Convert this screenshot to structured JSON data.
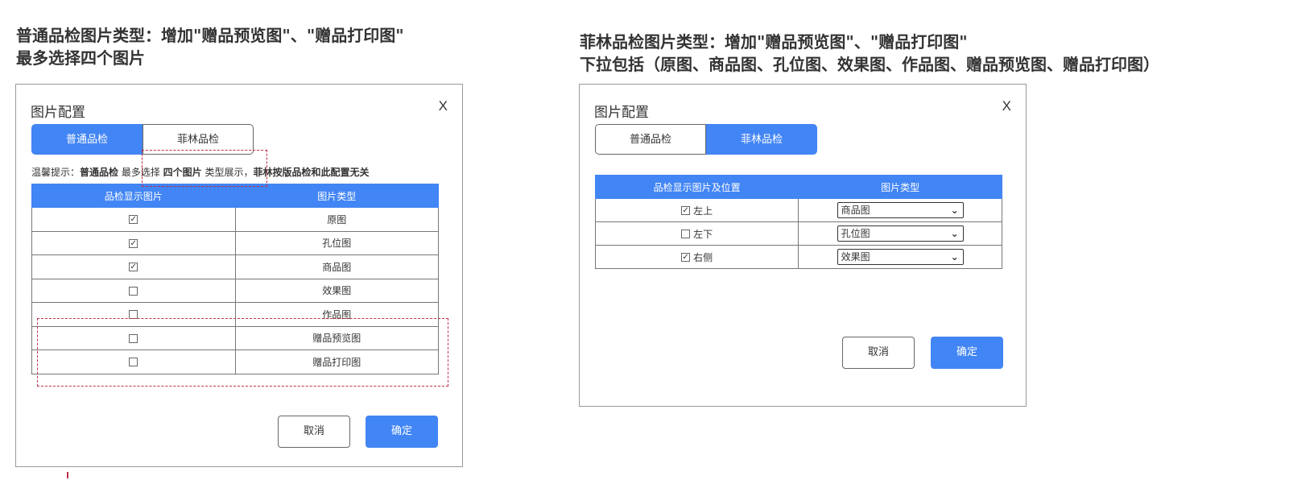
{
  "left_panel": {
    "heading_line1": "普通品检图片类型：增加\"赠品预览图\"、\"赠品打印图\"",
    "heading_line2": "最多选择四个图片",
    "dialog": {
      "title": "图片配置",
      "close": "X",
      "tabs": [
        {
          "label": "普通品检",
          "active": true
        },
        {
          "label": "菲林品检",
          "active": false
        }
      ],
      "tip": {
        "prefix": "温馨提示：",
        "b1": "普通品检",
        "mid1": " 最多选择 ",
        "b2": "四个图片",
        "mid2": " 类型展示，",
        "b3": "菲林按版品检和此配置无关"
      },
      "table": {
        "headers": [
          "品检显示图片",
          "图片类型"
        ],
        "rows": [
          {
            "checked": true,
            "type": "原图"
          },
          {
            "checked": true,
            "type": "孔位图"
          },
          {
            "checked": true,
            "type": "商品图"
          },
          {
            "checked": false,
            "type": "效果图"
          },
          {
            "checked": false,
            "type": "作品图"
          },
          {
            "checked": false,
            "type": "赠品预览图"
          },
          {
            "checked": false,
            "type": "赠品打印图"
          }
        ]
      },
      "cancel": "取消",
      "ok": "确定"
    }
  },
  "right_panel": {
    "heading_line1": "菲林品检图片类型：增加\"赠品预览图\"、\"赠品打印图\"",
    "heading_line2": "下拉包括（原图、商品图、孔位图、效果图、作品图、赠品预览图、赠品打印图）",
    "dialog": {
      "title": "图片配置",
      "close": "X",
      "tabs": [
        {
          "label": "普通品检",
          "active": false
        },
        {
          "label": "菲林品检",
          "active": true
        }
      ],
      "table": {
        "headers": [
          "品检显示图片及位置",
          "图片类型"
        ],
        "rows": [
          {
            "checked": true,
            "position": "左上",
            "type": "商品图"
          },
          {
            "checked": false,
            "position": "左下",
            "type": "孔位图"
          },
          {
            "checked": true,
            "position": "右侧",
            "type": "效果图"
          }
        ]
      },
      "cancel": "取消",
      "ok": "确定"
    }
  },
  "check_glyph": "✓",
  "chevron_glyph": "⌄",
  "colors": {
    "accent": "#4285f4",
    "annotation": "#c0304a"
  }
}
